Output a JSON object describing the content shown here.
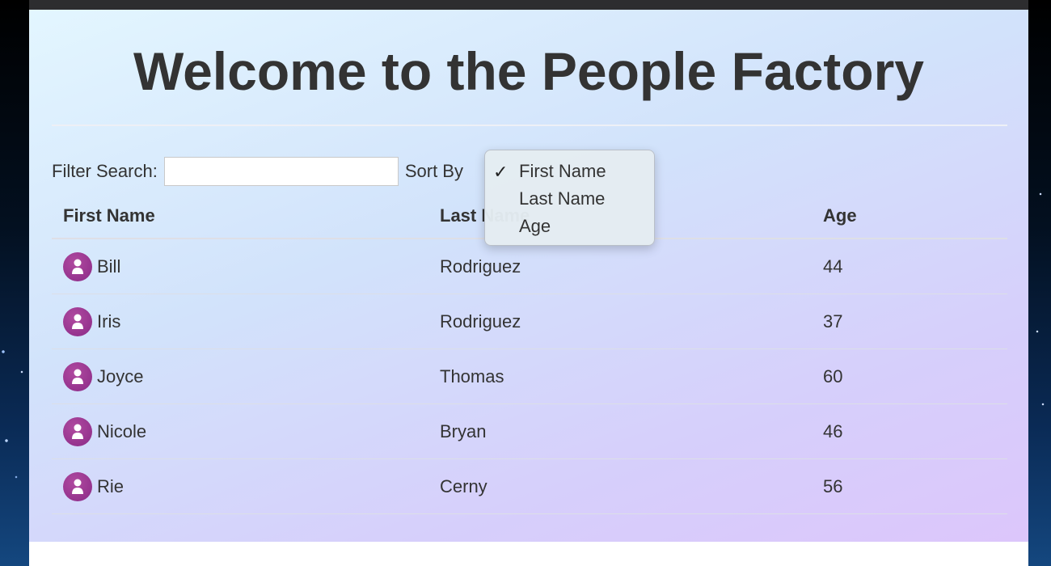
{
  "page": {
    "title": "Welcome to the People Factory"
  },
  "controls": {
    "filter_label": "Filter Search:",
    "filter_value": "",
    "sort_label": "Sort By",
    "sort_options": [
      "First Name",
      "Last Name",
      "Age"
    ],
    "sort_selected": "First Name",
    "checkmark": "✓"
  },
  "table": {
    "headers": [
      "First Name",
      "Last Name",
      "Age"
    ],
    "rows": [
      {
        "first": "Bill",
        "last": "Rodriguez",
        "age": "44",
        "icon": "person-icon"
      },
      {
        "first": "Iris",
        "last": "Rodriguez",
        "age": "37",
        "icon": "person-icon"
      },
      {
        "first": "Joyce",
        "last": "Thomas",
        "age": "60",
        "icon": "person-icon"
      },
      {
        "first": "Nicole",
        "last": "Bryan",
        "age": "46",
        "icon": "person-icon"
      },
      {
        "first": "Rie",
        "last": "Cerny",
        "age": "56",
        "icon": "person-icon"
      }
    ]
  },
  "colors": {
    "avatar": "#9c3a92",
    "text": "#333333"
  }
}
